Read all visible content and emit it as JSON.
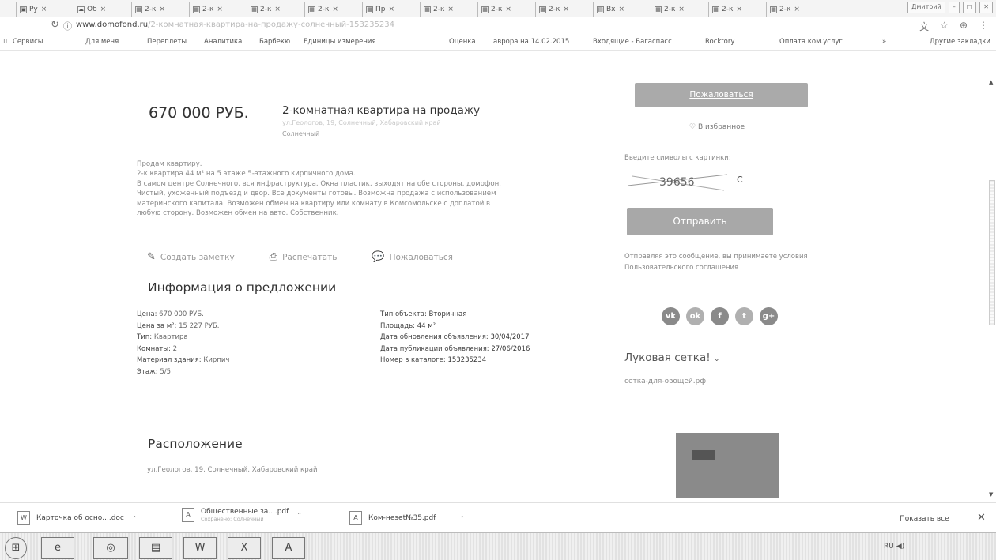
{
  "browser": {
    "tabs": [
      {
        "icon": "doc-icon",
        "label": "Ру"
      },
      {
        "icon": "cloud-icon",
        "label": "Об"
      },
      {
        "icon": "grid-icon",
        "label": "2-к"
      },
      {
        "icon": "grid-icon",
        "label": "2-к"
      },
      {
        "icon": "grid-icon",
        "label": "2-к"
      },
      {
        "icon": "grid-icon",
        "label": "2-к"
      },
      {
        "icon": "grid-icon",
        "label": "Пр"
      },
      {
        "icon": "grid-icon",
        "label": "2-к"
      },
      {
        "icon": "grid-icon",
        "label": "2-к"
      },
      {
        "icon": "grid-icon",
        "label": "2-к"
      },
      {
        "icon": "page-icon",
        "label": "Вх"
      },
      {
        "icon": "grid-icon",
        "label": "2-к"
      },
      {
        "icon": "grid-icon",
        "label": "2-к"
      },
      {
        "icon": "grid-icon",
        "label": "2-к"
      }
    ],
    "profile_label": "Дмитрий",
    "address_bar": {
      "url_domain": "www.domofond.ru",
      "url_rest": "/2-комнатная-квартира-на-продажу-солнечный-153235234"
    },
    "bookmarks": [
      "Сервисы",
      "Для меня",
      "Переплеты",
      "Аналитика",
      "Барбекю",
      "Единицы измерения",
      "Оценка",
      "аврора на 14.02.2015",
      "Входящие - Багаспасс",
      "Rocktory",
      "Оплата ком.услуг",
      "»",
      "Другие закладки"
    ]
  },
  "listing": {
    "price": "670 000 РУБ.",
    "title": "2-комнатная квартира на продажу",
    "subtitle": "ул.Геологов, 19, Солнечный, Хабаровский край",
    "town": "Солнечный",
    "description": [
      "Продам квартиру.",
      "2-к квартира 44 м² на 5 этаже 5-этажного кирпичного дома.",
      "В самом центре Солнечного, вся инфраструктура. Окна пластик, выходят на обе стороны, домофон.",
      "Чистый, ухоженный подъезд и двор. Все документы готовы. Возможна продажа с использованием",
      "материнского капитала. Возможен обмен на квартиру или комнату в Комсомольске с доплатой в",
      "любую сторону. Возможен обмен на авто. Собственник."
    ],
    "actions": {
      "note_label": "Создать заметку",
      "print_label": "Распечатать",
      "complain_label": "Пожаловаться"
    },
    "info_heading": "Информация о предложении",
    "info_left": [
      {
        "k": "Цена:",
        "v": " 670 000 РУБ."
      },
      {
        "k": "Цена за м²:",
        "v": " 15 227 РУБ."
      },
      {
        "k": "Тип:",
        "v": " Квартира"
      },
      {
        "k": "Комнаты:",
        "v": " 2"
      },
      {
        "k": "Материал здания:",
        "v": " Кирпич"
      },
      {
        "k": "Этаж:",
        "v": " 5/5"
      }
    ],
    "info_right": [
      {
        "k": "Тип объекта:",
        "v": " Вторичная"
      },
      {
        "k": "Площадь:",
        "v": " 44 м²"
      },
      {
        "k": "Дата обновления объявления:",
        "v": " 30/04/2017"
      },
      {
        "k": "Дата публикации объявления:",
        "v": " 27/06/2016"
      },
      {
        "k": "Номер в каталоге:",
        "v": " 153235234"
      }
    ],
    "location_heading": "Расположение",
    "address": "ул.Геологов, 19, Солнечный, Хабаровский край"
  },
  "sidebar": {
    "complain_button": "Пожаловаться",
    "favorites": "В избранное",
    "captcha_label": "Введите символы с картинки:",
    "captcha_text": "39656",
    "captcha_input": "С",
    "send_button": "Отправить",
    "terms_text": "Отправляя это сообщение, вы принимаете условия Пользовательского соглашения",
    "social": [
      "vk-icon",
      "odnoklassniki-icon",
      "facebook-icon",
      "twitter-icon",
      "google-plus-icon"
    ],
    "ad_title": "Луковая сетка!",
    "ad_url": "сетка-для-овощей.рф"
  },
  "downloads": {
    "items": [
      {
        "name": "Карточка об осно....doc",
        "sub": ""
      },
      {
        "name": "Общественные за....pdf",
        "sub": "Сохранено: Солнечный"
      },
      {
        "name": "Ком-неset№35.pdf",
        "sub": ""
      }
    ],
    "show_all": "Показать все"
  },
  "taskbar": {
    "tray_text": "RU"
  }
}
